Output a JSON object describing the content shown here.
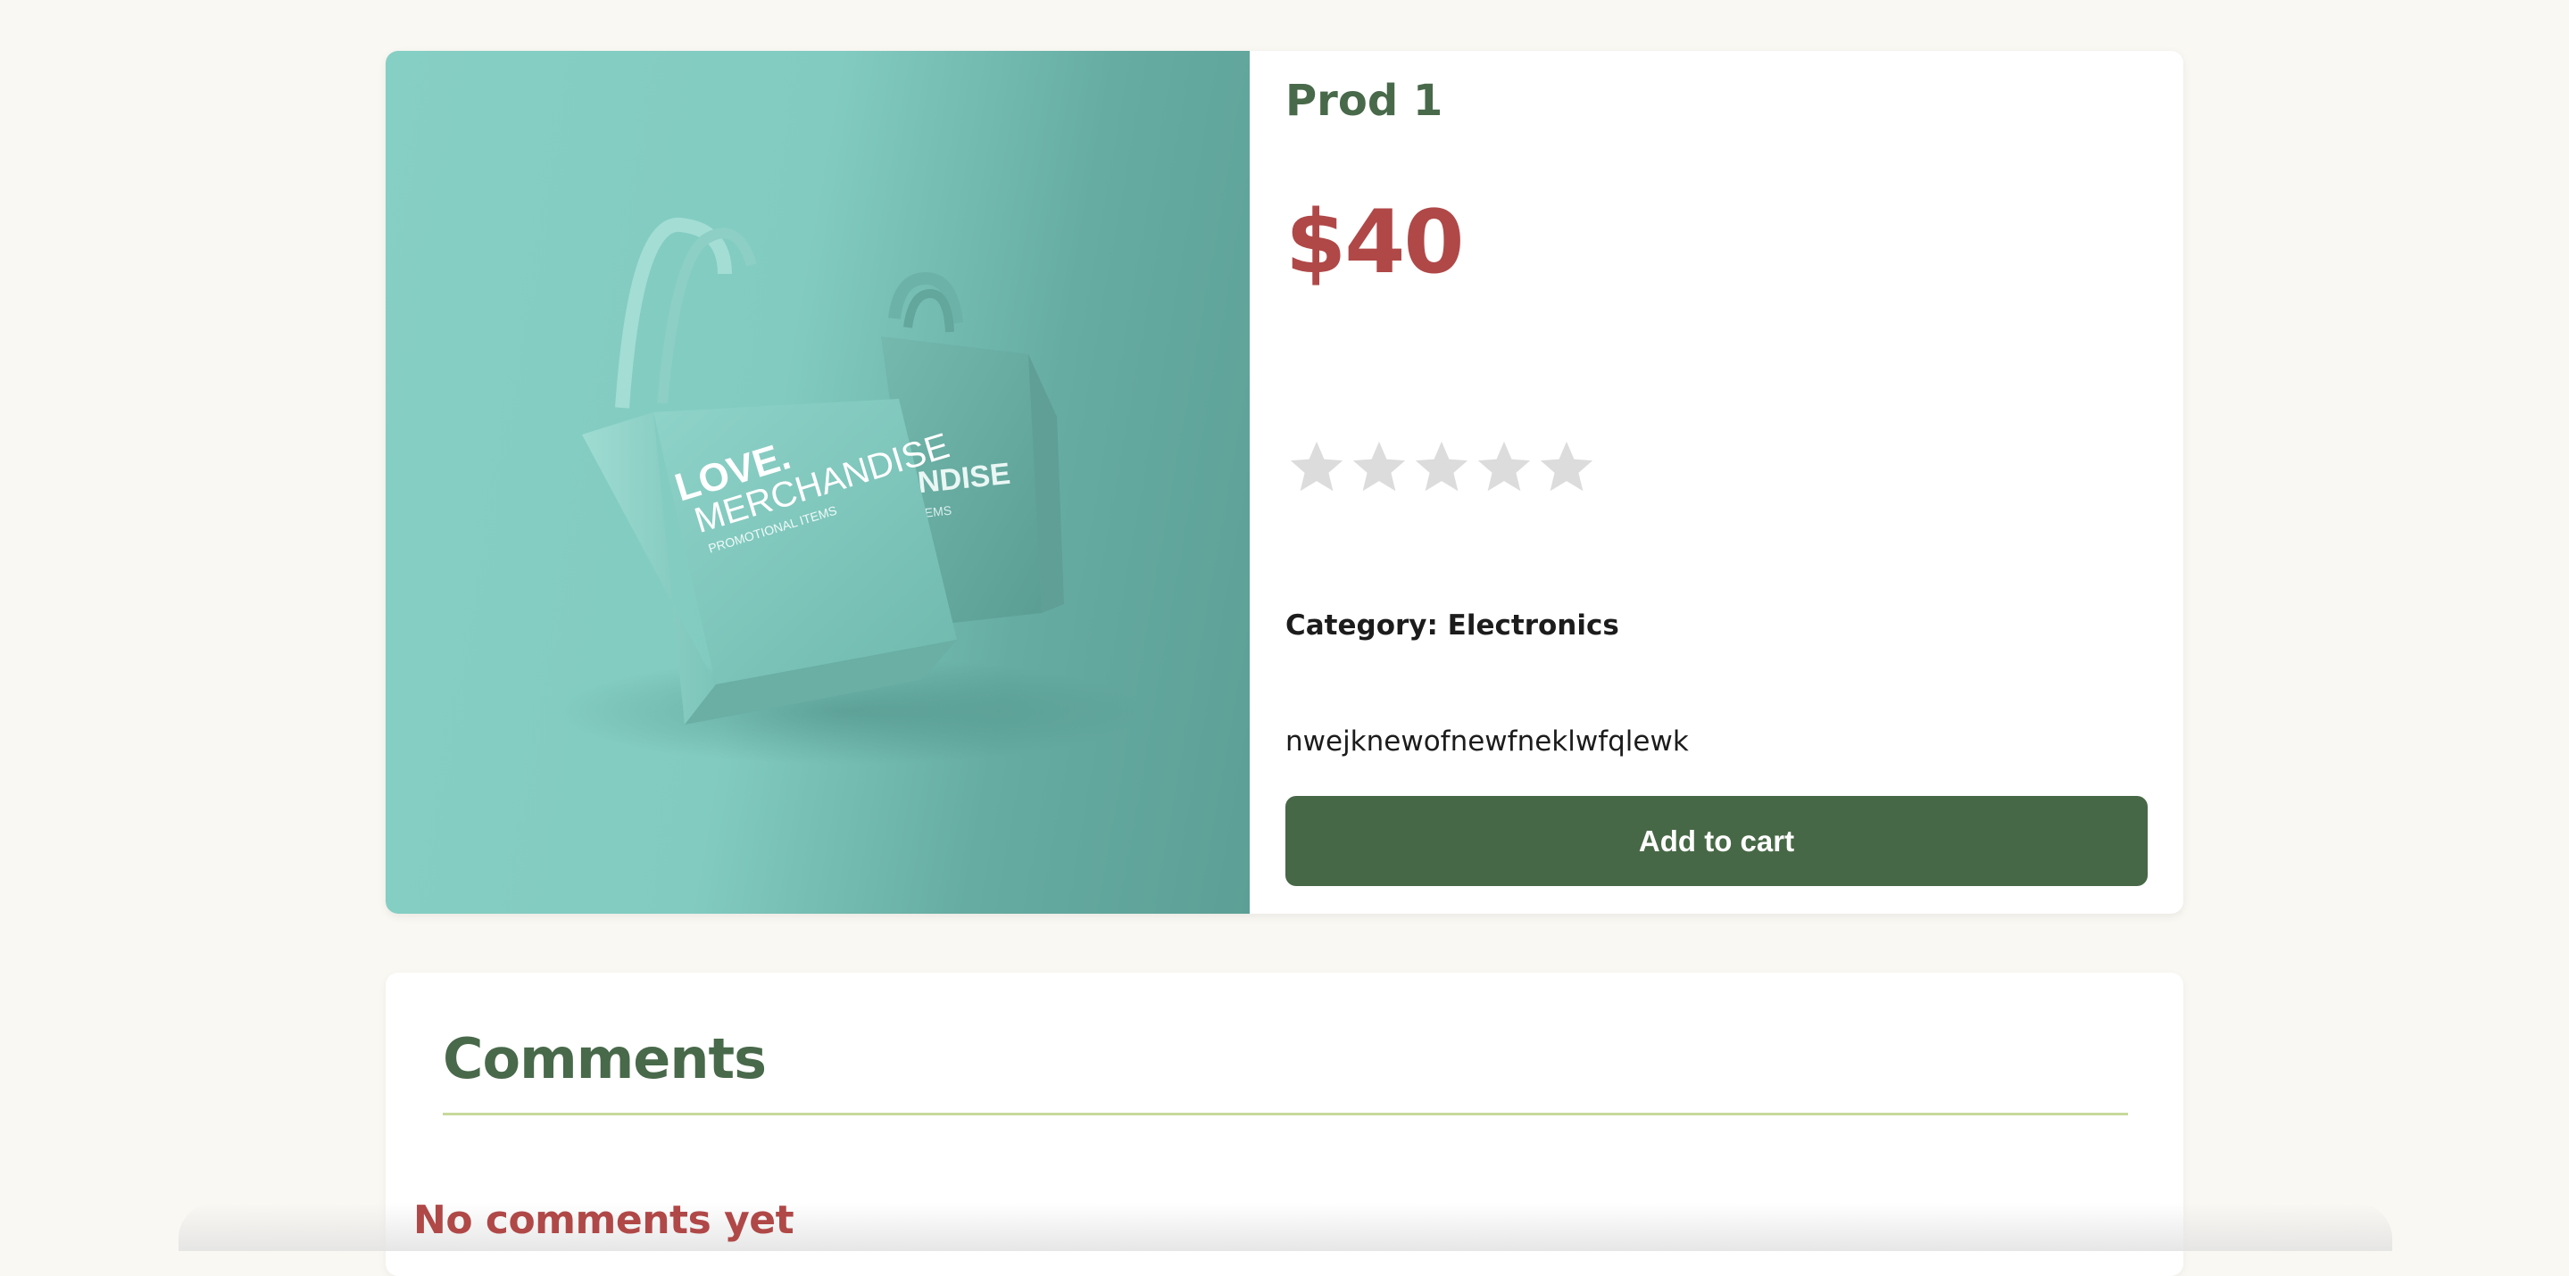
{
  "product": {
    "title": "Prod 1",
    "price": "$40",
    "rating": {
      "value": 0,
      "max": 5
    },
    "category_text": "Category: Electronics",
    "description": "nwejknewofnewfneklwfqlewk",
    "add_to_cart_label": "Add to cart",
    "image_logo_text": [
      "LOVE.",
      "MERCHANDISE",
      "PROMOTIONAL ITEMS"
    ]
  },
  "comments": {
    "title": "Comments",
    "empty_message": "No comments yet"
  },
  "colors": {
    "page_background": "#faf8f3",
    "title_green": "#48694a",
    "price_red": "#b04848",
    "button_green": "#476846",
    "star_empty": "#dcdcdc",
    "divider": "#c8d99a"
  },
  "icons": {
    "star": "star-icon"
  }
}
